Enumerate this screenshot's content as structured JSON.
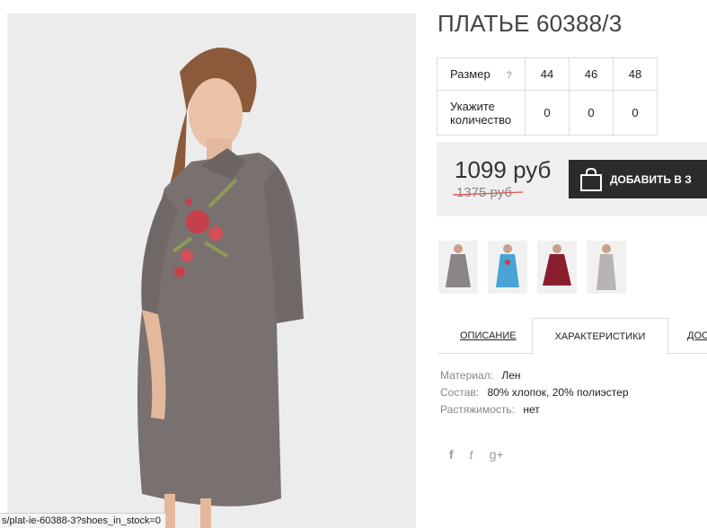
{
  "product": {
    "title": "ПЛАТЬЕ 60388/3",
    "image_alt": "model-in-grey-shirt-dress"
  },
  "size_table": {
    "size_label": "Размер",
    "help_icon": "?",
    "sizes": [
      "44",
      "46",
      "48"
    ],
    "qty_label_line1": "Укажите",
    "qty_label_line2": "количество",
    "quantities": [
      "0",
      "0",
      "0"
    ]
  },
  "price": {
    "current": "1099 руб",
    "old": "1375 руб",
    "add_to_cart": "ДОБАВИТЬ В З",
    "strike_color": "#d9534f"
  },
  "thumbnails": [
    {
      "name": "grey",
      "color": "#8a8586"
    },
    {
      "name": "blue",
      "color": "#4aa3d6"
    },
    {
      "name": "burgundy",
      "color": "#8b1e2e"
    },
    {
      "name": "light-grey",
      "color": "#b9b4b3"
    }
  ],
  "tabs": {
    "description": "ОПИСАНИЕ",
    "characteristics": "ХАРАКТЕРИСТИКИ",
    "delivery": "ДОС"
  },
  "specs": {
    "material_key": "Материал:",
    "material_val": "Лен",
    "composition_key": "Состав:",
    "composition_val": "80% хлопок, 20% полиэстер",
    "stretch_key": "Растяжимость:",
    "stretch_val": "нет"
  },
  "social": {
    "facebook": "f",
    "twitter": "t",
    "googleplus": "g+"
  },
  "status_bar": {
    "url": "s/plat-ie-60388-3?shoes_in_stock=0"
  }
}
